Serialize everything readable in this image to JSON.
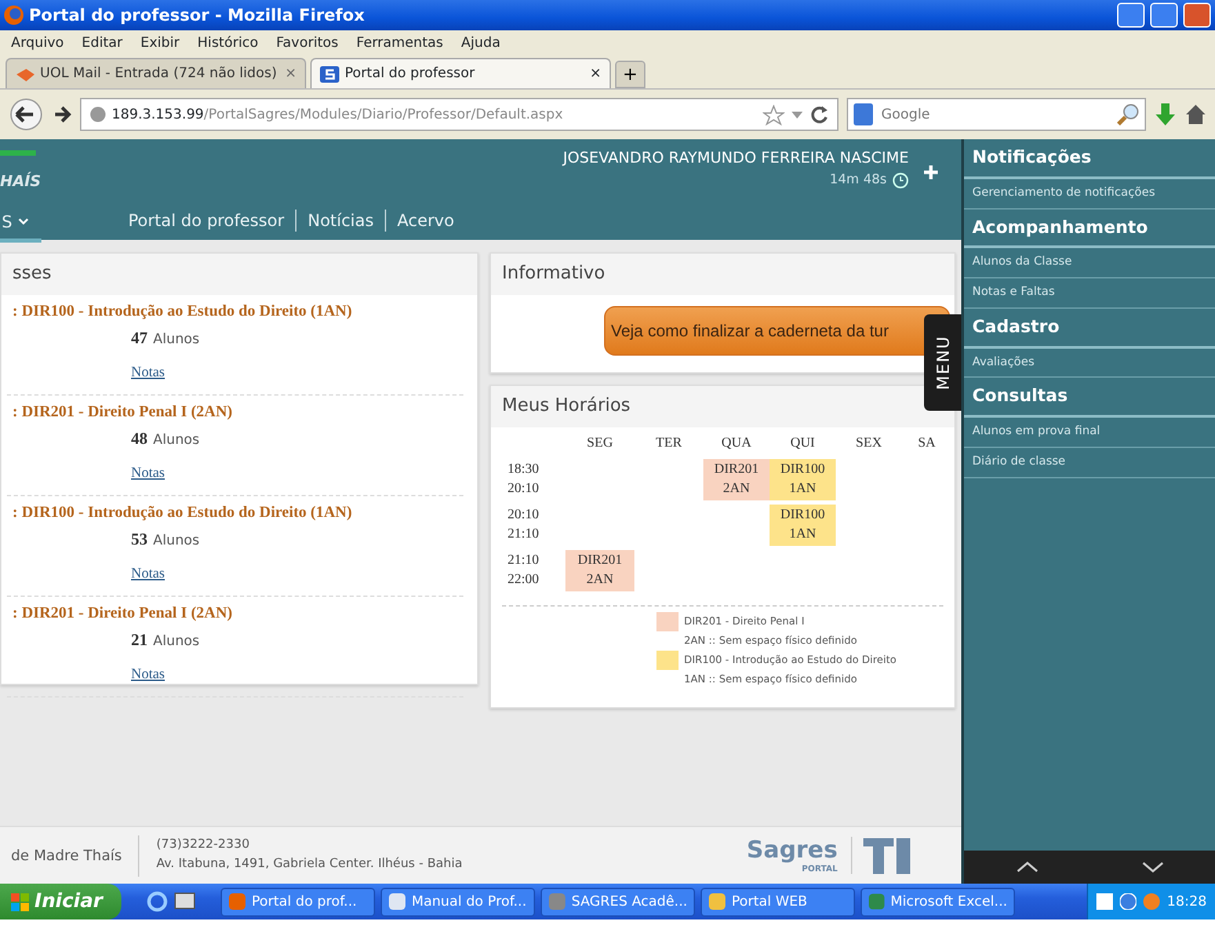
{
  "window": {
    "title": "Portal do professor - Mozilla Firefox"
  },
  "menu_bar": [
    "Arquivo",
    "Editar",
    "Exibir",
    "Histórico",
    "Favoritos",
    "Ferramentas",
    "Ajuda"
  ],
  "tabs": [
    {
      "label": "UOL Mail - Entrada (724 não lidos)",
      "selected": false,
      "close": "×"
    },
    {
      "label": "Portal do professor",
      "selected": true,
      "close": "×"
    }
  ],
  "new_tab": "+",
  "address_bar": {
    "host": "189.3.153.99",
    "path": "/PortalSagres/Modules/Diario/Professor/Default.aspx"
  },
  "search": {
    "placeholder": "Google"
  },
  "header": {
    "logo_text": "HAÍS",
    "user_name": "JOSEVANDRO RAYMUNDO FERREIRA NASCIME",
    "session_timer": "14m 48s",
    "nav": [
      {
        "label": "S",
        "selected": true,
        "dropdown": true
      },
      {
        "label": "Portal do professor",
        "selected": false,
        "dropdown": false
      },
      {
        "label": "Notícias",
        "selected": false,
        "dropdown": false
      },
      {
        "label": "Acervo",
        "selected": false,
        "dropdown": false
      }
    ]
  },
  "classes_panel": {
    "title": "sses",
    "items": [
      {
        "title": ": DIR100 - Introdução ao Estudo do Direito (1AN)",
        "count": "47",
        "unit": "Alunos",
        "link": "Notas"
      },
      {
        "title": ": DIR201 - Direito Penal I (2AN)",
        "count": "48",
        "unit": "Alunos",
        "link": "Notas"
      },
      {
        "title": ": DIR100 - Introdução ao Estudo do Direito (1AN)",
        "count": "53",
        "unit": "Alunos",
        "link": "Notas"
      },
      {
        "title": ": DIR201 - Direito Penal I (2AN)",
        "count": "21",
        "unit": "Alunos",
        "link": "Notas"
      }
    ]
  },
  "info_panel": {
    "title": "Informativo",
    "banner": "Veja como finalizar a caderneta da tur"
  },
  "schedule": {
    "title": "Meus Horários",
    "days": [
      "SEG",
      "TER",
      "QUA",
      "QUI",
      "SEX",
      "SA"
    ],
    "rows": [
      {
        "start": "18:30",
        "end": "20:10",
        "cells": [
          null,
          null,
          {
            "code": "DIR201",
            "group": "2AN",
            "color": "#f9d3c0"
          },
          {
            "code": "DIR100",
            "group": "1AN",
            "color": "#fde38a"
          },
          null,
          null
        ]
      },
      {
        "start": "20:10",
        "end": "21:10",
        "cells": [
          null,
          null,
          null,
          {
            "code": "DIR100",
            "group": "1AN",
            "color": "#fde38a"
          },
          null,
          null
        ]
      },
      {
        "start": "21:10",
        "end": "22:00",
        "cells": [
          {
            "code": "DIR201",
            "group": "2AN",
            "color": "#f9d3c0"
          },
          null,
          null,
          null,
          null,
          null
        ]
      }
    ],
    "legend": [
      {
        "color": "#f9d3c0",
        "title": "DIR201 - Direito Penal I",
        "room": "2AN :: Sem espaço físico definido"
      },
      {
        "color": "#fde38a",
        "title": "DIR100 - Introdução ao Estudo do Direito",
        "room": "1AN :: Sem espaço físico definido"
      }
    ]
  },
  "menu_tab": "MENU",
  "side_menu": [
    {
      "title": "Notificações",
      "items": [
        "Gerenciamento de notificações"
      ]
    },
    {
      "title": "Acompanhamento",
      "items": [
        "Alunos da Classe",
        "Notas e Faltas"
      ]
    },
    {
      "title": "Cadastro",
      "items": [
        "Avaliações"
      ]
    },
    {
      "title": "Consultas",
      "items": [
        "Alunos em prova final",
        "Diário de classe"
      ]
    }
  ],
  "footer": {
    "name": "de Madre Thaís",
    "phone": "(73)3222-2330",
    "address": "Av. Itabuna, 1491, Gabriela Center. Ilhéus - Bahia",
    "logo_main": "Sagres",
    "logo_sub": "PORTAL"
  },
  "taskbar": {
    "start": "Iniciar",
    "tasks": [
      "Portal do prof...",
      "Manual do Prof...",
      "SAGRES Acadê...",
      "Portal WEB",
      "Microsoft Excel..."
    ],
    "clock": "18:28"
  }
}
